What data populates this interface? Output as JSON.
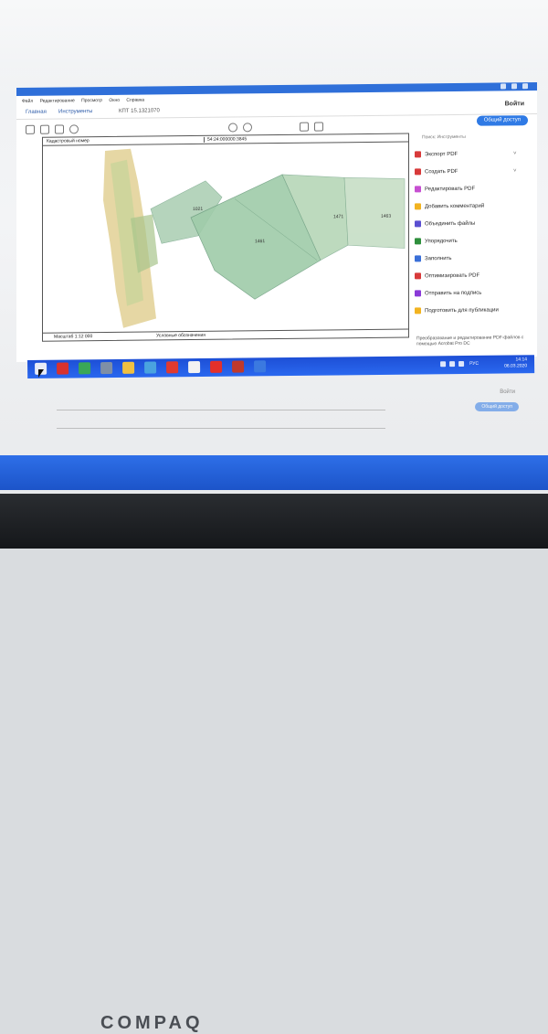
{
  "window": {
    "menu": [
      "Файл",
      "Редактирование",
      "Просмотр",
      "Окно",
      "Справка"
    ],
    "tabs": {
      "home": "Главная",
      "tools": "Инструменты",
      "document": "КПТ 15.1321070"
    },
    "login": "Войти",
    "share": "Общий доступ"
  },
  "document": {
    "header_label": "Кадастровый номер",
    "header_value": "54:24:000000:3845",
    "footer_scale": "Масштаб 1:12 000",
    "footer_legend": "Условные обозначения",
    "plot_labels": [
      "1021",
      "1461",
      "1471",
      "1463"
    ]
  },
  "panel": {
    "title": "Поиск: Инструменты",
    "items": [
      {
        "label": "Экспорт PDF",
        "color": "#d83a3a",
        "chevron": true
      },
      {
        "label": "Создать PDF",
        "color": "#d83a3a",
        "chevron": true
      },
      {
        "label": "Редактировать PDF",
        "color": "#c64fd1",
        "chevron": false
      },
      {
        "label": "Добавить комментарий",
        "color": "#f2b320",
        "chevron": false
      },
      {
        "label": "Объединить файлы",
        "color": "#5a4fd1",
        "chevron": false
      },
      {
        "label": "Упорядочить",
        "color": "#2e8f3c",
        "chevron": false
      },
      {
        "label": "Заполнить",
        "color": "#3a6fd8",
        "chevron": false
      },
      {
        "label": "Оптимизировать PDF",
        "color": "#d83a3a",
        "chevron": false
      },
      {
        "label": "Отправить на подпись",
        "color": "#8a3ad8",
        "chevron": false
      },
      {
        "label": "Подготовить для публикации",
        "color": "#f2b320",
        "chevron": false
      }
    ],
    "promo": "Преобразование и редактирование PDF-файлов с помощью Acrobat Pro DC"
  },
  "taskbar": {
    "apps": [
      {
        "name": "start-icon",
        "color": "#e8ecf7"
      },
      {
        "name": "opera-icon",
        "color": "#d8322e"
      },
      {
        "name": "chrome-icon",
        "color": "#3aa757"
      },
      {
        "name": "settings-icon",
        "color": "#7f8fa6"
      },
      {
        "name": "explorer-icon",
        "color": "#f0c040"
      },
      {
        "name": "photos-icon",
        "color": "#4aa3df"
      },
      {
        "name": "acrobat-icon",
        "color": "#e03a2f"
      },
      {
        "name": "media-icon",
        "color": "#f2f2f2"
      },
      {
        "name": "yandex-icon",
        "color": "#e4302a"
      },
      {
        "name": "game-icon",
        "color": "#c0392b"
      },
      {
        "name": "mail-icon",
        "color": "#3b79e0"
      }
    ],
    "language": "РУС",
    "time": "14:14",
    "date": "06.03.2020"
  },
  "monitor_brand": "COMPAQ"
}
